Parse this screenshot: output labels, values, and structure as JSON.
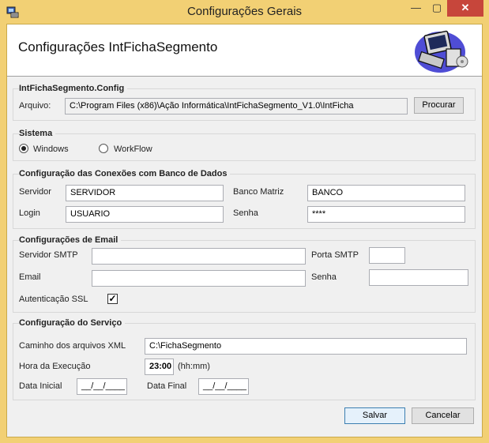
{
  "window": {
    "title": "Configurações Gerais",
    "controls": {
      "minimize": "—",
      "maximize": "▢",
      "close": "✕"
    }
  },
  "header": {
    "title": "Configurações IntFichaSegmento"
  },
  "config_group": {
    "title": "IntFichaSegmento.Config",
    "arquivo_label": "Arquivo:",
    "arquivo_value": "C:\\Program Files (x86)\\Ação Informática\\IntFichaSegmento_V1.0\\IntFicha",
    "procurar_label": "Procurar"
  },
  "sistema_group": {
    "title": "Sistema",
    "options": [
      {
        "label": "Windows",
        "selected": true
      },
      {
        "label": "WorkFlow",
        "selected": false
      }
    ]
  },
  "db_group": {
    "title": "Configuração das Conexões com Banco de Dados",
    "servidor_label": "Servidor",
    "servidor_value": "SERVIDOR",
    "banco_label": "Banco Matriz",
    "banco_value": "BANCO",
    "login_label": "Login",
    "login_value": "USUARIO",
    "senha_label": "Senha",
    "senha_value": "****"
  },
  "email_group": {
    "title": "Configurações de Email",
    "smtp_label": "Servidor SMTP",
    "smtp_value": "",
    "porta_label": "Porta SMTP",
    "porta_value": "",
    "email_label": "Email",
    "email_value": "",
    "senha_label": "Senha",
    "senha_value": "",
    "ssl_label": "Autenticação SSL",
    "ssl_checked": true
  },
  "servico_group": {
    "title": "Configuração do Serviço",
    "caminho_label": "Caminho dos arquivos XML",
    "caminho_value": "C:\\FichaSegmento",
    "hora_label": "Hora da Execução",
    "hora_value": "23:00",
    "hora_hint": "(hh:mm)",
    "data_inicial_label": "Data Inicial",
    "data_inicial_value": "__/__/____",
    "data_final_label": "Data Final",
    "data_final_value": "__/__/____"
  },
  "footer": {
    "salvar_label": "Salvar",
    "cancelar_label": "Cancelar"
  }
}
